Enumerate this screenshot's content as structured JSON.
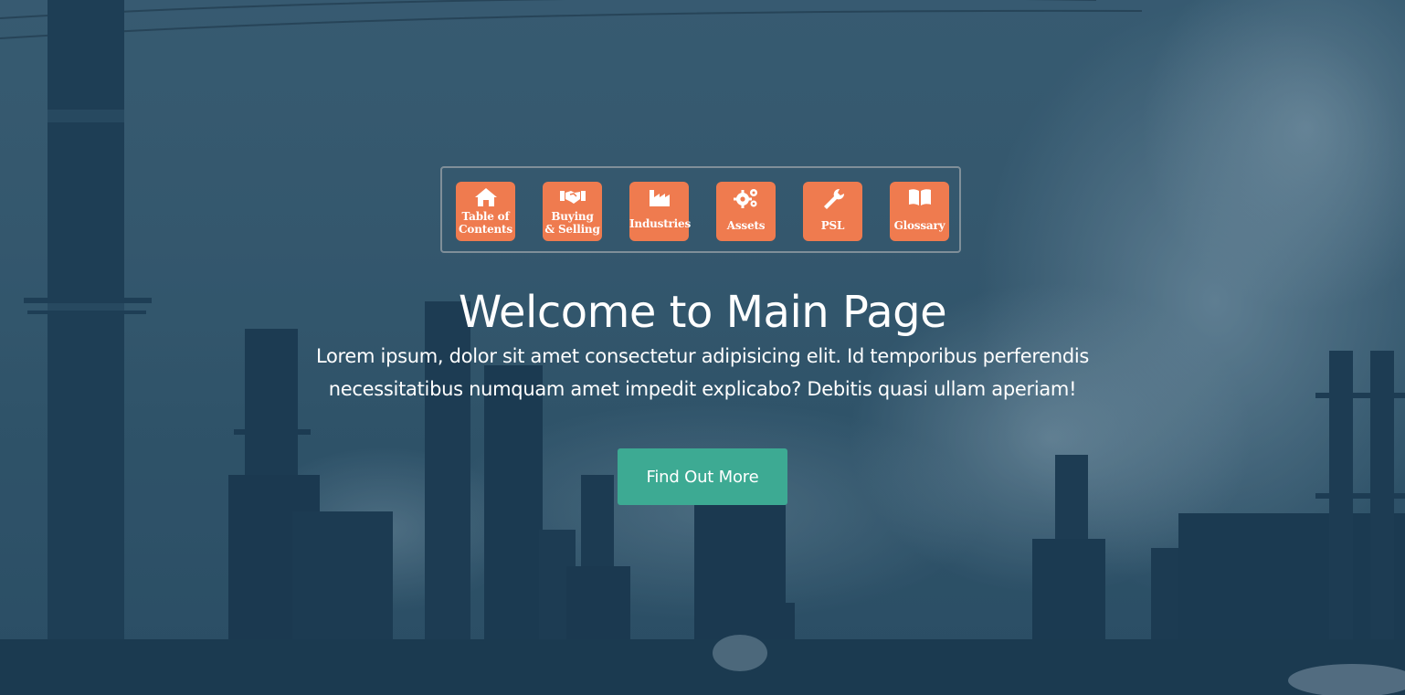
{
  "nav": {
    "items": [
      {
        "label_line1": "Table of",
        "label_line2": "Contents",
        "icon": "home-icon"
      },
      {
        "label_line1": "Buying",
        "label_line2": "& Selling",
        "icon": "handshake-icon"
      },
      {
        "label_line1": "Industries",
        "label_line2": "",
        "icon": "factory-icon"
      },
      {
        "label_line1": "Assets",
        "label_line2": "",
        "icon": "gears-icon"
      },
      {
        "label_line1": "PSL",
        "label_line2": "",
        "icon": "wrench-icon"
      },
      {
        "label_line1": "Glossary",
        "label_line2": "",
        "icon": "book-icon"
      }
    ]
  },
  "hero": {
    "title": "Welcome to Main Page",
    "subtitle_line1": "Lorem ipsum, dolor sit amet consectetur adipisicing elit. Id temporibus perferendis",
    "subtitle_line2": "necessitatibus numquam amet impedit explicabo? Debitis quasi ullam aperiam!",
    "cta_label": "Find Out More"
  },
  "colors": {
    "tile": "#ef7b4f",
    "cta": "#3daa93",
    "background": "#3a5b70"
  }
}
